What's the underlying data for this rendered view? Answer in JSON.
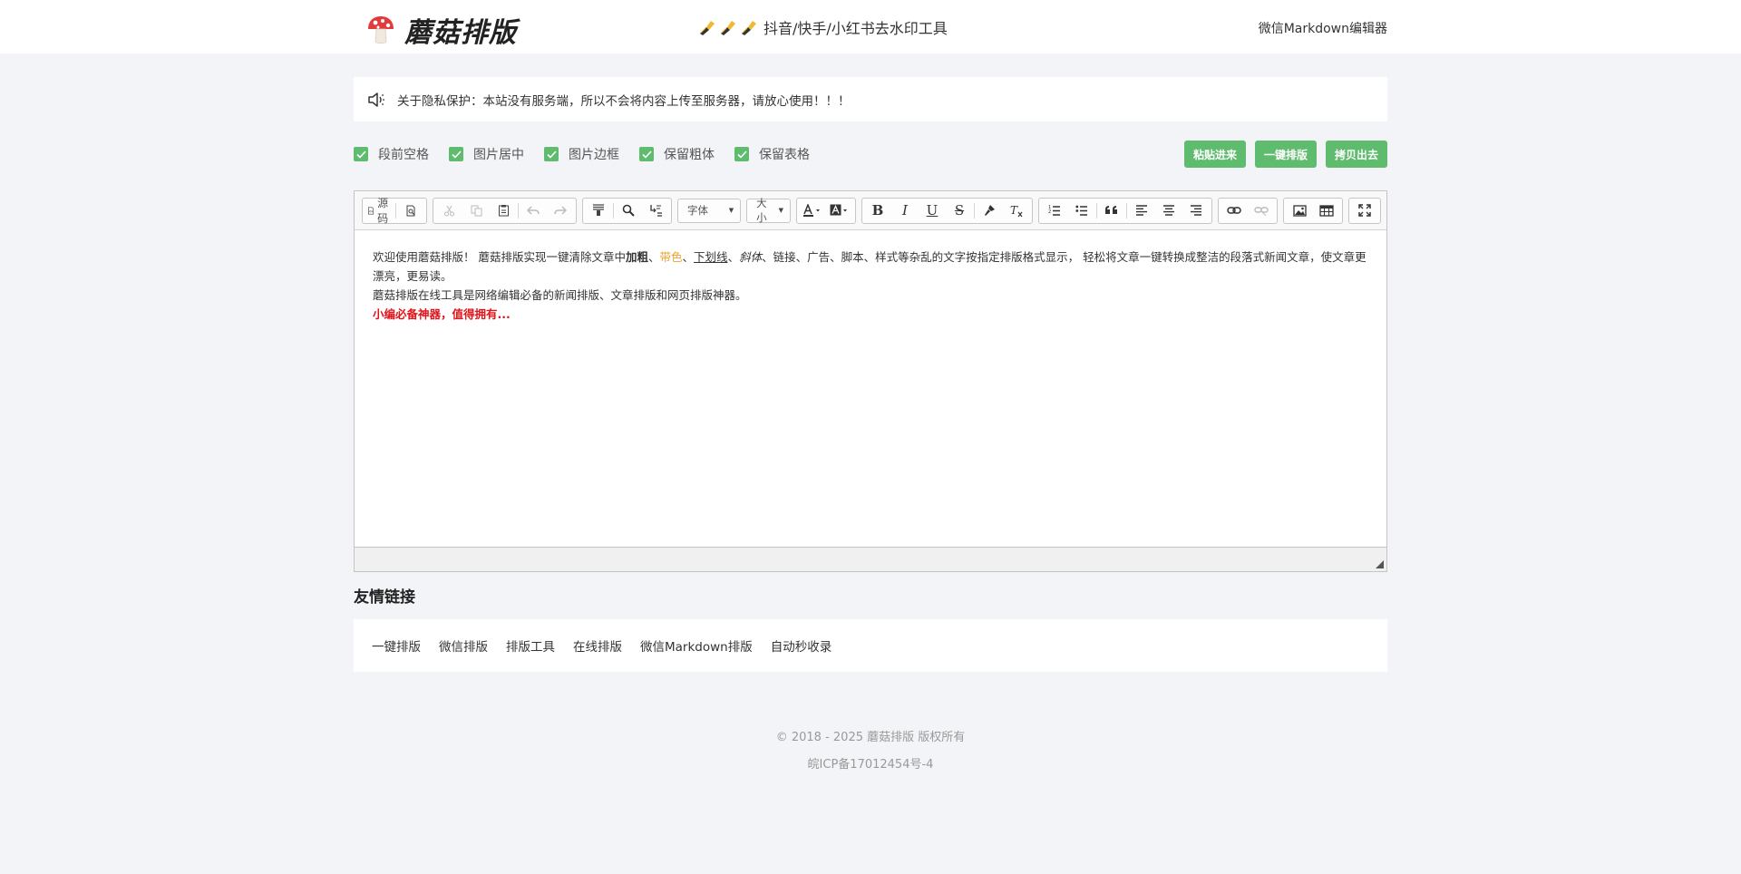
{
  "header": {
    "logo_text": "蘑菇排版",
    "center_link": "抖音/快手/小红书去水印工具",
    "right_link": "微信Markdown编辑器"
  },
  "notice": {
    "text": "关于隐私保护：本站没有服务端，所以不会将内容上传至服务器，请放心使用！！！"
  },
  "options": [
    {
      "label": "段前空格",
      "checked": true
    },
    {
      "label": "图片居中",
      "checked": true
    },
    {
      "label": "图片边框",
      "checked": true
    },
    {
      "label": "保留粗体",
      "checked": true
    },
    {
      "label": "保留表格",
      "checked": true
    }
  ],
  "actions": {
    "paste": "粘贴进来",
    "format": "一键排版",
    "copy": "拷贝出去"
  },
  "toolbar": {
    "source": "源码",
    "font_select": "字体",
    "size_select": "大小",
    "bold": "B",
    "italic": "I",
    "underline": "U",
    "strike": "S"
  },
  "content": {
    "p1_a": "欢迎使用蘑菇排版！ 蘑菇排版实现一键清除文章中",
    "p1_bold": "加粗",
    "p1_sep1": "、",
    "p1_color": "带色",
    "p1_sep2": "、",
    "p1_underline": "下划线",
    "p1_sep3": "、",
    "p1_italic": "斜体",
    "p1_b": "、链接、广告、脚本、样式等杂乱的文字按指定排版格式显示， 轻松将文章一键转换成整洁的段落式新闻文章，使文章更漂亮，更易读。",
    "p2": "蘑菇排版在线工具是网络编辑必备的新闻排版、文章排版和网页排版神器。",
    "p3": "小编必备神器，值得拥有..."
  },
  "friends": {
    "title": "友情链接",
    "links": [
      "一键排版",
      "微信排版",
      "排版工具",
      "在线排版",
      "微信Markdown排版",
      "自动秒收录"
    ]
  },
  "footer": {
    "copyright": "© 2018 - 2025 蘑菇排版 版权所有",
    "icp": "皖ICP备17012454号-4"
  },
  "colors": {
    "accent_green": "#5fbb6e",
    "highlight_orange": "#f0a22e",
    "highlight_red": "#e0141a",
    "page_bg": "#f3f4f7"
  }
}
